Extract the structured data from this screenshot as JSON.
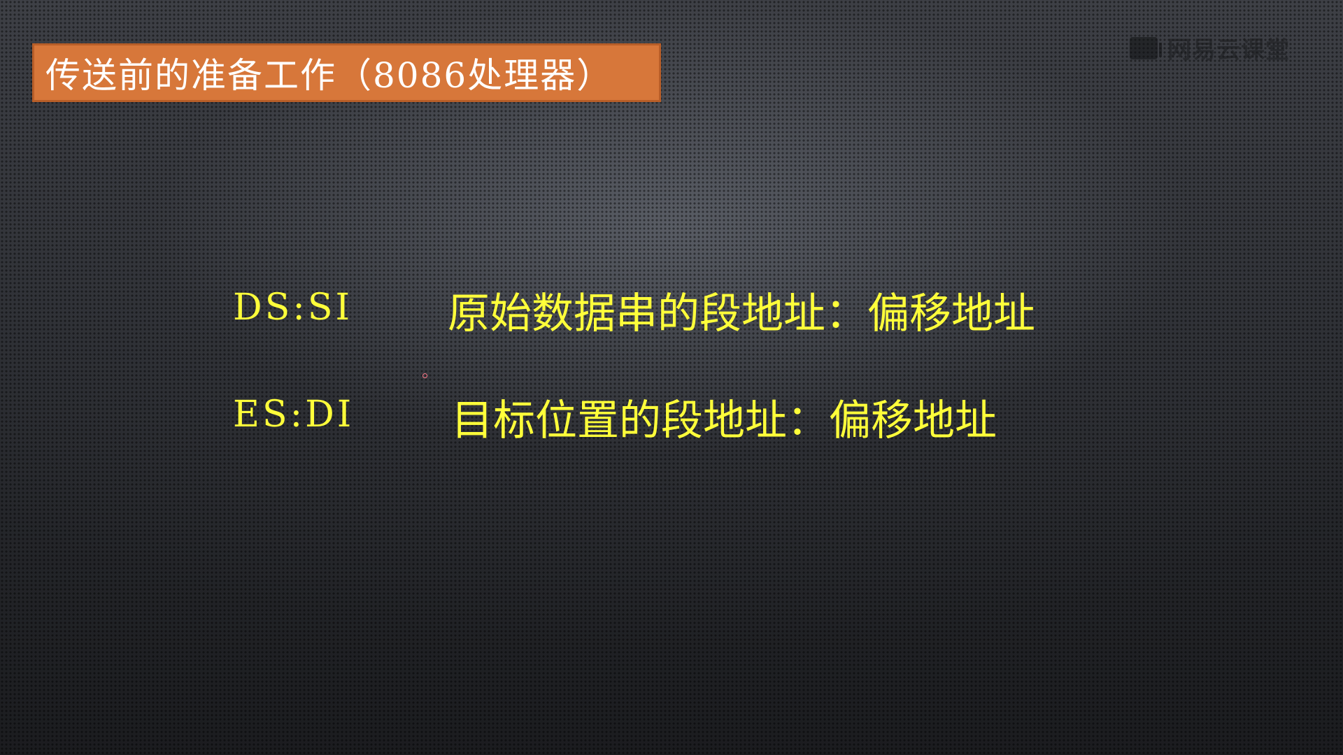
{
  "slide": {
    "title": "传送前的准备工作（8086处理器）",
    "logo_text": "网易云课堂",
    "logo_icon": "netease-cloud-classroom-logo-icon",
    "colors": {
      "title_background": "#d7773a",
      "title_text": "#ffffff",
      "body_text": "#ffff3a"
    },
    "rows": [
      {
        "register": "DS:SI",
        "description": "原始数据串的段地址：偏移地址"
      },
      {
        "register": "ES:DI",
        "description": "目标位置的段地址：偏移地址"
      }
    ]
  }
}
